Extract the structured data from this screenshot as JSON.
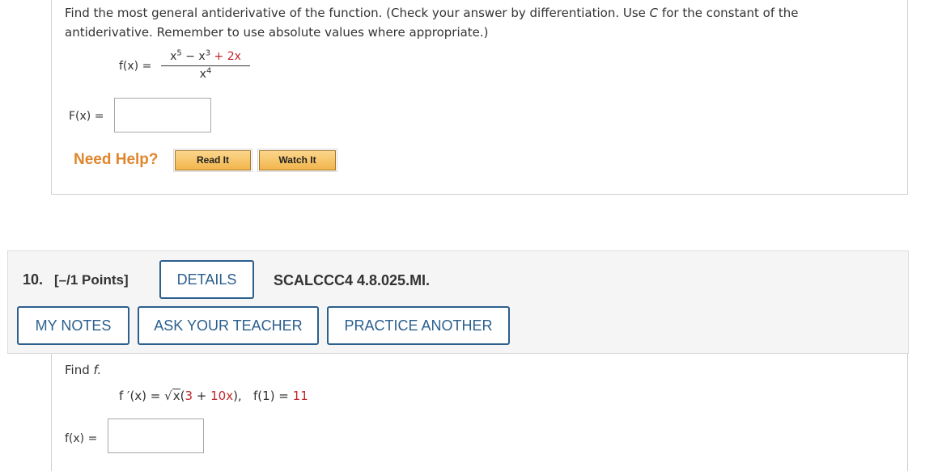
{
  "q9": {
    "prompt_pre": "Find the most general antiderivative of the function. (Check your answer by differentiation. Use ",
    "prompt_c": "C",
    "prompt_post": " for the constant of the antiderivative. Remember to use absolute values where appropriate.)",
    "function_lhs": "f(x) =",
    "numerator_a": "x",
    "numerator_a_exp": "5",
    "numerator_mid": " − x",
    "numerator_mid_exp": "3",
    "numerator_tail": " + 2x",
    "denominator": "x",
    "denominator_exp": "4",
    "answer_label": "F(x) =",
    "answer_value": "",
    "need_help": "Need Help?",
    "read_it": "Read It",
    "watch_it": "Watch It"
  },
  "q10": {
    "number": "10.",
    "points": "[–/1 Points]",
    "details_label": "DETAILS",
    "code": "SCALCCC4 4.8.025.MI.",
    "my_notes": "MY NOTES",
    "ask_teacher": "ASK YOUR TEACHER",
    "practice_another": "PRACTICE ANOTHER",
    "find_text": "Find",
    "find_var": "f.",
    "deriv_lhs": "f ′(x) = ",
    "sqrt_arg": "x",
    "paren_open": "(",
    "inner_3": "3",
    "inner_plus": " + ",
    "inner_10x": "10x",
    "paren_close": "),",
    "cond_lhs": "f(1) = ",
    "cond_value": "11",
    "answer_label": "f(x) =",
    "answer_value": ""
  },
  "colors": {
    "accent_blue": "#2b5f8e",
    "need_help_orange": "#e0852c",
    "red_value": "#c0272d"
  }
}
